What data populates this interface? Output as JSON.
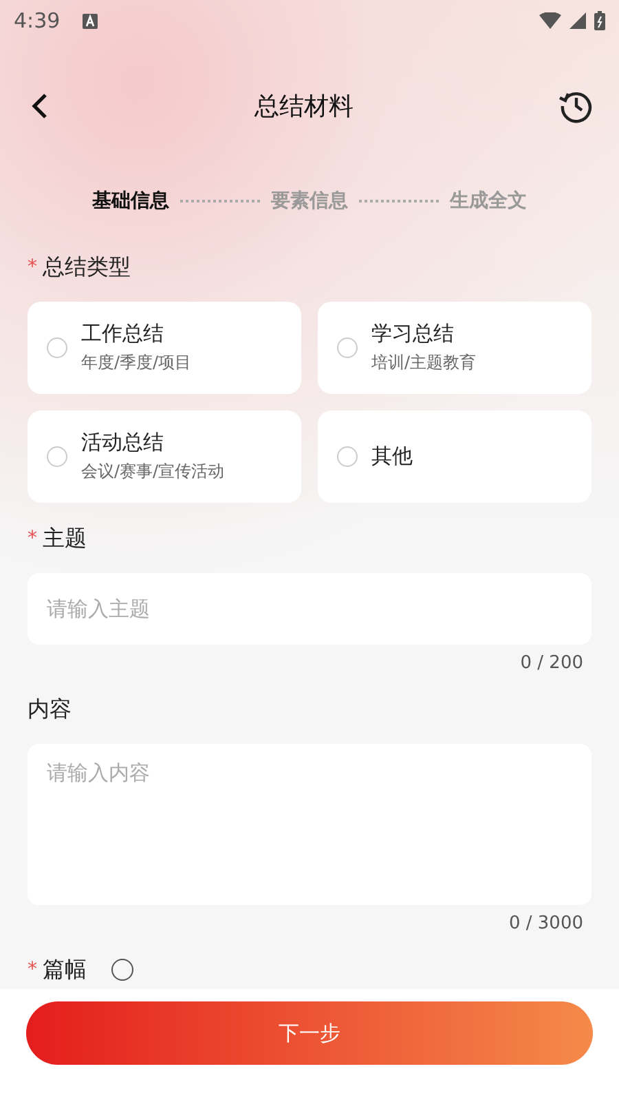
{
  "status_bar": {
    "time": "4:39"
  },
  "header": {
    "title": "总结材料"
  },
  "steps": [
    {
      "label": "基础信息",
      "selected": true
    },
    {
      "label": "要素信息",
      "selected": false
    },
    {
      "label": "生成全文",
      "selected": false
    }
  ],
  "summary_type": {
    "label": "总结类型",
    "required_mark": "*",
    "options": [
      {
        "title": "工作总结",
        "subtitle": "年度/季度/项目",
        "selected": false
      },
      {
        "title": "学习总结",
        "subtitle": "培训/主题教育",
        "selected": false
      },
      {
        "title": "活动总结",
        "subtitle": "会议/赛事/宣传活动",
        "selected": false
      },
      {
        "title": "其他",
        "selected": false
      }
    ]
  },
  "topic": {
    "label": "主题",
    "required_mark": "*",
    "placeholder": "请输入主题",
    "counter": "0 / 200"
  },
  "content": {
    "label": "内容",
    "placeholder": "请输入内容",
    "counter": "0 / 3000"
  },
  "length": {
    "label": "篇幅",
    "required_mark": "*"
  },
  "next_button": "下一步"
}
